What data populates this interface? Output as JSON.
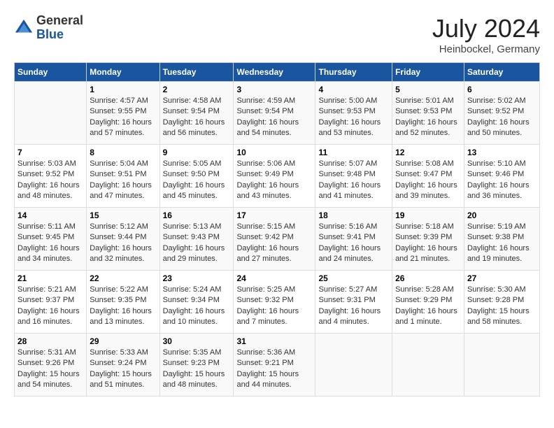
{
  "header": {
    "logo_general": "General",
    "logo_blue": "Blue",
    "month_title": "July 2024",
    "location": "Heinbockel, Germany"
  },
  "weekdays": [
    "Sunday",
    "Monday",
    "Tuesday",
    "Wednesday",
    "Thursday",
    "Friday",
    "Saturday"
  ],
  "weeks": [
    [
      {
        "day": "",
        "sunrise": "",
        "sunset": "",
        "daylight": ""
      },
      {
        "day": "1",
        "sunrise": "Sunrise: 4:57 AM",
        "sunset": "Sunset: 9:55 PM",
        "daylight": "Daylight: 16 hours and 57 minutes."
      },
      {
        "day": "2",
        "sunrise": "Sunrise: 4:58 AM",
        "sunset": "Sunset: 9:54 PM",
        "daylight": "Daylight: 16 hours and 56 minutes."
      },
      {
        "day": "3",
        "sunrise": "Sunrise: 4:59 AM",
        "sunset": "Sunset: 9:54 PM",
        "daylight": "Daylight: 16 hours and 54 minutes."
      },
      {
        "day": "4",
        "sunrise": "Sunrise: 5:00 AM",
        "sunset": "Sunset: 9:53 PM",
        "daylight": "Daylight: 16 hours and 53 minutes."
      },
      {
        "day": "5",
        "sunrise": "Sunrise: 5:01 AM",
        "sunset": "Sunset: 9:53 PM",
        "daylight": "Daylight: 16 hours and 52 minutes."
      },
      {
        "day": "6",
        "sunrise": "Sunrise: 5:02 AM",
        "sunset": "Sunset: 9:52 PM",
        "daylight": "Daylight: 16 hours and 50 minutes."
      }
    ],
    [
      {
        "day": "7",
        "sunrise": "Sunrise: 5:03 AM",
        "sunset": "Sunset: 9:52 PM",
        "daylight": "Daylight: 16 hours and 48 minutes."
      },
      {
        "day": "8",
        "sunrise": "Sunrise: 5:04 AM",
        "sunset": "Sunset: 9:51 PM",
        "daylight": "Daylight: 16 hours and 47 minutes."
      },
      {
        "day": "9",
        "sunrise": "Sunrise: 5:05 AM",
        "sunset": "Sunset: 9:50 PM",
        "daylight": "Daylight: 16 hours and 45 minutes."
      },
      {
        "day": "10",
        "sunrise": "Sunrise: 5:06 AM",
        "sunset": "Sunset: 9:49 PM",
        "daylight": "Daylight: 16 hours and 43 minutes."
      },
      {
        "day": "11",
        "sunrise": "Sunrise: 5:07 AM",
        "sunset": "Sunset: 9:48 PM",
        "daylight": "Daylight: 16 hours and 41 minutes."
      },
      {
        "day": "12",
        "sunrise": "Sunrise: 5:08 AM",
        "sunset": "Sunset: 9:47 PM",
        "daylight": "Daylight: 16 hours and 39 minutes."
      },
      {
        "day": "13",
        "sunrise": "Sunrise: 5:10 AM",
        "sunset": "Sunset: 9:46 PM",
        "daylight": "Daylight: 16 hours and 36 minutes."
      }
    ],
    [
      {
        "day": "14",
        "sunrise": "Sunrise: 5:11 AM",
        "sunset": "Sunset: 9:45 PM",
        "daylight": "Daylight: 16 hours and 34 minutes."
      },
      {
        "day": "15",
        "sunrise": "Sunrise: 5:12 AM",
        "sunset": "Sunset: 9:44 PM",
        "daylight": "Daylight: 16 hours and 32 minutes."
      },
      {
        "day": "16",
        "sunrise": "Sunrise: 5:13 AM",
        "sunset": "Sunset: 9:43 PM",
        "daylight": "Daylight: 16 hours and 29 minutes."
      },
      {
        "day": "17",
        "sunrise": "Sunrise: 5:15 AM",
        "sunset": "Sunset: 9:42 PM",
        "daylight": "Daylight: 16 hours and 27 minutes."
      },
      {
        "day": "18",
        "sunrise": "Sunrise: 5:16 AM",
        "sunset": "Sunset: 9:41 PM",
        "daylight": "Daylight: 16 hours and 24 minutes."
      },
      {
        "day": "19",
        "sunrise": "Sunrise: 5:18 AM",
        "sunset": "Sunset: 9:39 PM",
        "daylight": "Daylight: 16 hours and 21 minutes."
      },
      {
        "day": "20",
        "sunrise": "Sunrise: 5:19 AM",
        "sunset": "Sunset: 9:38 PM",
        "daylight": "Daylight: 16 hours and 19 minutes."
      }
    ],
    [
      {
        "day": "21",
        "sunrise": "Sunrise: 5:21 AM",
        "sunset": "Sunset: 9:37 PM",
        "daylight": "Daylight: 16 hours and 16 minutes."
      },
      {
        "day": "22",
        "sunrise": "Sunrise: 5:22 AM",
        "sunset": "Sunset: 9:35 PM",
        "daylight": "Daylight: 16 hours and 13 minutes."
      },
      {
        "day": "23",
        "sunrise": "Sunrise: 5:24 AM",
        "sunset": "Sunset: 9:34 PM",
        "daylight": "Daylight: 16 hours and 10 minutes."
      },
      {
        "day": "24",
        "sunrise": "Sunrise: 5:25 AM",
        "sunset": "Sunset: 9:32 PM",
        "daylight": "Daylight: 16 hours and 7 minutes."
      },
      {
        "day": "25",
        "sunrise": "Sunrise: 5:27 AM",
        "sunset": "Sunset: 9:31 PM",
        "daylight": "Daylight: 16 hours and 4 minutes."
      },
      {
        "day": "26",
        "sunrise": "Sunrise: 5:28 AM",
        "sunset": "Sunset: 9:29 PM",
        "daylight": "Daylight: 16 hours and 1 minute."
      },
      {
        "day": "27",
        "sunrise": "Sunrise: 5:30 AM",
        "sunset": "Sunset: 9:28 PM",
        "daylight": "Daylight: 15 hours and 58 minutes."
      }
    ],
    [
      {
        "day": "28",
        "sunrise": "Sunrise: 5:31 AM",
        "sunset": "Sunset: 9:26 PM",
        "daylight": "Daylight: 15 hours and 54 minutes."
      },
      {
        "day": "29",
        "sunrise": "Sunrise: 5:33 AM",
        "sunset": "Sunset: 9:24 PM",
        "daylight": "Daylight: 15 hours and 51 minutes."
      },
      {
        "day": "30",
        "sunrise": "Sunrise: 5:35 AM",
        "sunset": "Sunset: 9:23 PM",
        "daylight": "Daylight: 15 hours and 48 minutes."
      },
      {
        "day": "31",
        "sunrise": "Sunrise: 5:36 AM",
        "sunset": "Sunset: 9:21 PM",
        "daylight": "Daylight: 15 hours and 44 minutes."
      },
      {
        "day": "",
        "sunrise": "",
        "sunset": "",
        "daylight": ""
      },
      {
        "day": "",
        "sunrise": "",
        "sunset": "",
        "daylight": ""
      },
      {
        "day": "",
        "sunrise": "",
        "sunset": "",
        "daylight": ""
      }
    ]
  ]
}
